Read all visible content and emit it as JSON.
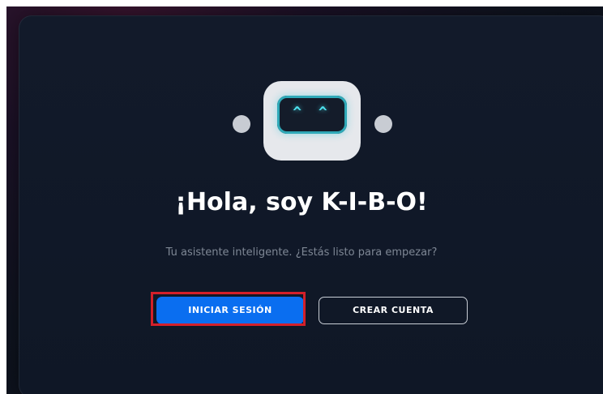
{
  "welcome": {
    "title": "¡Hola, soy K-I-B-O!",
    "subtitle": "Tu asistente inteligente. ¿Estás listo para empezar?"
  },
  "robot": {
    "eyes": "^ ^",
    "icon": "robot-icon",
    "eye_color": "#4de3f0"
  },
  "buttons": {
    "login_label": "INICIAR SESIÓN",
    "register_label": "CREAR CUENTA"
  },
  "colors": {
    "primary": "#0a6ef0",
    "highlight": "#d3202a",
    "background": "#0f1726"
  }
}
